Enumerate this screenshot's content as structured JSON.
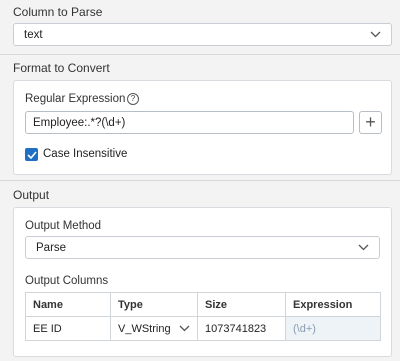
{
  "column_to_parse": {
    "heading": "Column to Parse",
    "value": "text"
  },
  "format_to_convert": {
    "heading": "Format to Convert",
    "regex_label": "Regular Expression",
    "help_icon": "question-circle-icon",
    "regex_value": "Employee:.*?(\\d+)",
    "add_button_icon": "plus-icon",
    "case_insensitive_label": "Case Insensitive",
    "case_insensitive_checked": true
  },
  "output": {
    "heading": "Output",
    "method_label": "Output Method",
    "method_value": "Parse",
    "columns_label": "Output Columns",
    "columns_headers": [
      "Name",
      "Type",
      "Size",
      "Expression"
    ],
    "rows": [
      {
        "name": "EE ID",
        "type": "V_WString",
        "size": "1073741823",
        "expression": "(\\d+)"
      }
    ]
  }
}
